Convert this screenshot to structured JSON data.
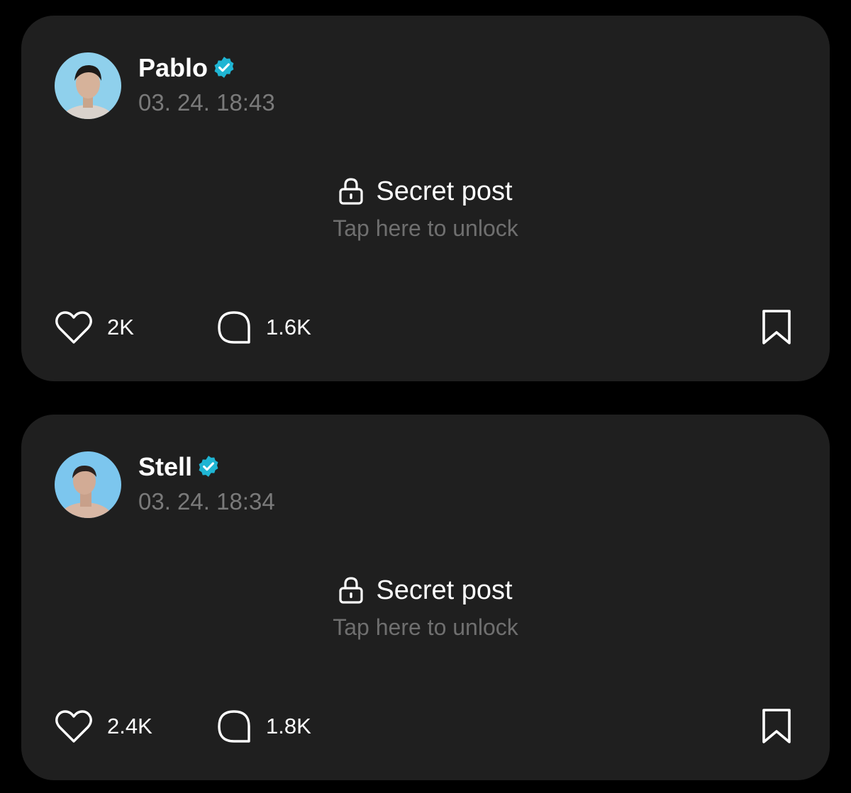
{
  "posts": [
    {
      "author": "Pablo",
      "verified": true,
      "timestamp": "03. 24. 18:43",
      "secret_title": "Secret post",
      "unlock_hint": "Tap here to unlock",
      "likes": "2K",
      "comments": "1.6K",
      "avatar_bg": "#8fd0ec"
    },
    {
      "author": "Stell",
      "verified": true,
      "timestamp": "03. 24. 18:34",
      "secret_title": "Secret post",
      "unlock_hint": "Tap here to unlock",
      "likes": "2.4K",
      "comments": "1.8K",
      "avatar_bg": "#7cc6ee"
    }
  ],
  "colors": {
    "page_bg": "#000000",
    "card_bg": "#1f1f1f",
    "verified": "#1fb5d3",
    "muted_text": "#7a7a7a",
    "text": "#ffffff"
  },
  "icons": {
    "verified": "verified-badge-icon",
    "lock": "lock-icon",
    "like": "heart-icon",
    "comment": "comment-bubble-icon",
    "bookmark": "bookmark-icon"
  }
}
